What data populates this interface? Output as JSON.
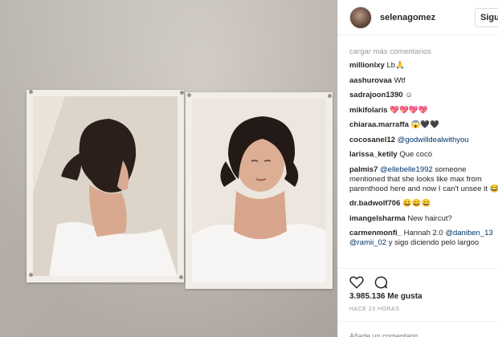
{
  "header": {
    "username": "selenagomez",
    "follow_label": "Siguie"
  },
  "comments": {
    "load_more": "cargar más comentarios",
    "items": [
      {
        "user": "millionlxy",
        "text": "Lb🙏"
      },
      {
        "user": "aashurovaa",
        "text": "Wtf"
      },
      {
        "user": "sadrajoon1390",
        "text": "☺"
      },
      {
        "user": "mikifolaris",
        "text": "💖💖💖💖"
      },
      {
        "user": "chiaraa.marraffa",
        "text": "😱🖤🖤"
      },
      {
        "user": "cocosanel12",
        "mention": "@godwilldealwithyou",
        "text": ""
      },
      {
        "user": "larissa_ketily",
        "text": "Que cocó"
      },
      {
        "user": "palmis7",
        "mention": "@ellebelle1992",
        "text": "someone mentioned that she looks like max from parenthood here and now I can't unsee it 😂"
      },
      {
        "user": "dr.badwolf706",
        "text": "😀😀😀"
      },
      {
        "user": "imangelsharma",
        "text": "New haircut?"
      },
      {
        "user": "carmenmonfi_",
        "text": "Hannah 2.0",
        "mention": "@daniben_13",
        "mention2": "@ramii_02",
        "text2": "y sigo diciendo pelo largoo"
      }
    ]
  },
  "actions": {
    "like_icon": "heart-icon",
    "comment_icon": "comment-bubble-icon"
  },
  "likes": "3.985.136 Me gusta",
  "time": "HACE 23 HORAS",
  "add_comment_placeholder": "Añade un comentario..."
}
